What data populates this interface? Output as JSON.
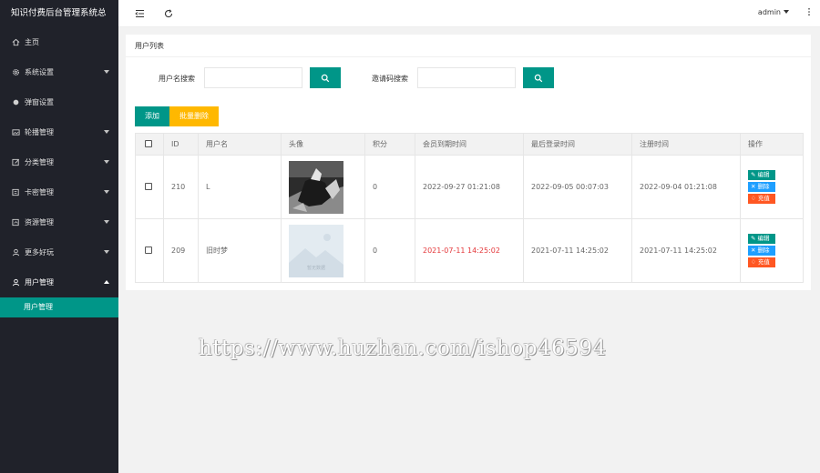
{
  "app": {
    "title": "知识付费后台管理系统总"
  },
  "sidebar": {
    "items": [
      {
        "label": "主页",
        "icon": "home-icon",
        "has_arrow": false
      },
      {
        "label": "系统设置",
        "icon": "gear-icon",
        "has_arrow": true
      },
      {
        "label": "弹窗设置",
        "icon": "dot-icon",
        "has_arrow": false
      },
      {
        "label": "轮播管理",
        "icon": "image-icon",
        "has_arrow": true
      },
      {
        "label": "分类管理",
        "icon": "edit-icon",
        "has_arrow": true
      },
      {
        "label": "卡密管理",
        "icon": "card-icon",
        "has_arrow": true
      },
      {
        "label": "资源管理",
        "icon": "resource-icon",
        "has_arrow": true
      },
      {
        "label": "更多好玩",
        "icon": "user-icon",
        "has_arrow": true
      },
      {
        "label": "用户管理",
        "icon": "user-icon",
        "has_arrow": true,
        "expanded": true
      }
    ],
    "sub_items": [
      {
        "label": "用户管理"
      }
    ]
  },
  "topbar": {
    "user": "admin"
  },
  "card": {
    "title": "用户列表",
    "search": {
      "username_label": "用户名搜索",
      "invite_label": "邀请码搜索"
    },
    "add_label": "添加",
    "batch_delete_label": "批量删除"
  },
  "table": {
    "headers": [
      "ID",
      "用户名",
      "头像",
      "积分",
      "会员到期时间",
      "最后登录时间",
      "注册时间",
      "操作"
    ],
    "rows": [
      {
        "id": "210",
        "username": "L",
        "points": "0",
        "vip_expire": "2022-09-27 01:21:08",
        "vip_expired": false,
        "last_login": "2022-09-05 00:07:03",
        "register": "2022-09-04 01:21:08"
      },
      {
        "id": "209",
        "username": "旧时梦",
        "points": "0",
        "vip_expire": "2021-07-11 14:25:02",
        "vip_expired": true,
        "last_login": "2021-07-11 14:25:02",
        "register": "2021-07-11 14:25:02"
      }
    ],
    "ops": {
      "edit": "编辑",
      "delete": "删除",
      "recharge": "充值"
    },
    "placeholder_image_text": "暂无数据"
  },
  "watermark": "https://www.huzhan.com/ishop46594",
  "colors": {
    "sidebar": "#20222a",
    "primary": "#009688",
    "warning": "#ffb800",
    "info": "#1e9fff",
    "danger": "#ff5722",
    "expired": "#e4393c"
  }
}
